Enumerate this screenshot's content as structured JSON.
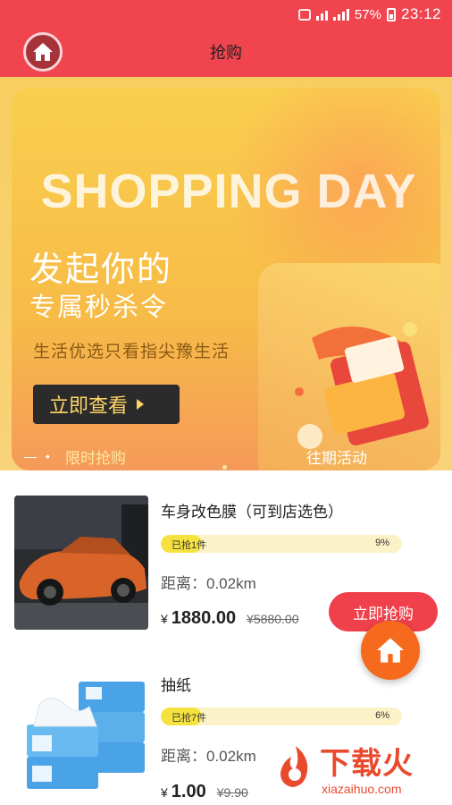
{
  "status": {
    "battery": "57%",
    "time": "23:12"
  },
  "header": {
    "title": "抢购"
  },
  "banner": {
    "bg_word": "SHOPPING DAY",
    "headline1": "发起你的",
    "headline2": "专属秒杀令",
    "subtitle": "生活优选只看指尖豫生活",
    "cta_label": "立即查看",
    "tab_left": "限时抢购",
    "tab_right": "往期活动"
  },
  "products": [
    {
      "name": "车身改色膜（可到店选色）",
      "sold_label": "已抢1件",
      "percent_label": "9%",
      "percent": 9,
      "distance": "距离：0.02km",
      "currency": "¥",
      "price": "1880.00",
      "old_price": "¥5880.00",
      "buy_label": "立即抢购"
    },
    {
      "name": "抽纸",
      "sold_label": "已抢7件",
      "percent_label": "6%",
      "percent": 6,
      "distance": "距离：0.02km",
      "currency": "¥",
      "price": "1.00",
      "old_price": "¥9.90"
    }
  ],
  "watermark": {
    "brand": "下载火",
    "domain": "xiazaihuo.com"
  },
  "colors": {
    "primary": "#f0444f",
    "banner": "#f9cf4e",
    "fab": "#f56a1d",
    "progress": "#f6e23f"
  }
}
